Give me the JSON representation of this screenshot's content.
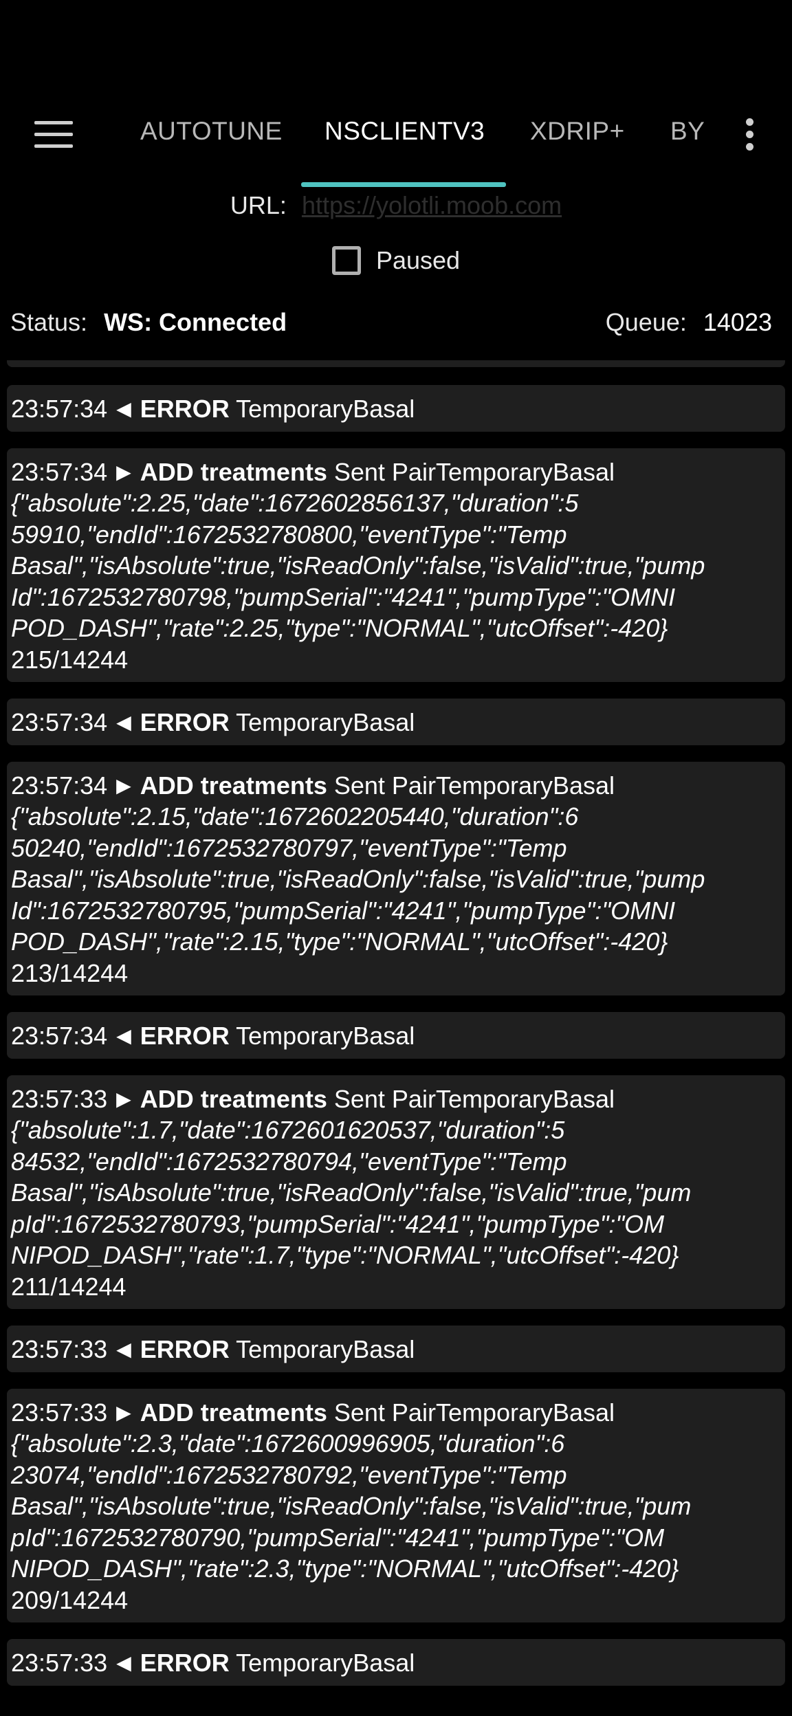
{
  "toolbar": {
    "menu_icon": "hamburger-menu-icon",
    "overflow_icon": "more-vertical-icon",
    "accent_color": "#4fc3c0",
    "tabs": [
      {
        "label": "AUTOTUNE",
        "active": false
      },
      {
        "label": "NSCLIENTV3",
        "active": true
      },
      {
        "label": "XDRIP+",
        "active": false
      },
      {
        "label": "BY",
        "active": false
      }
    ]
  },
  "url": {
    "label": "URL:",
    "value": "https://yolotli.moob.com"
  },
  "paused": {
    "label": "Paused",
    "checked": false
  },
  "status": {
    "label": "Status:",
    "value": "WS: Connected",
    "queue_label": "Queue:",
    "queue_value": "14023"
  },
  "logs": [
    {
      "time": "23:57:34",
      "dir": "◄",
      "action": "ERROR",
      "text": "TemporaryBasal"
    },
    {
      "time": "23:57:34",
      "dir": "►",
      "action": "ADD treatments",
      "text": "Sent PairTemporaryBasal",
      "json": "{\"absolute\":2.25,\"date\":1672602856137,\"duration\":5\n59910,\"endId\":1672532780800,\"eventType\":\"Temp\nBasal\",\"isAbsolute\":true,\"isReadOnly\":false,\"isValid\":true,\"pump\nId\":1672532780798,\"pumpSerial\":\"4241\",\"pumpType\":\"OMNI\nPOD_DASH\",\"rate\":2.25,\"type\":\"NORMAL\",\"utcOffset\":-420}",
      "count": "215/14244"
    },
    {
      "time": "23:57:34",
      "dir": "◄",
      "action": "ERROR",
      "text": "TemporaryBasal"
    },
    {
      "time": "23:57:34",
      "dir": "►",
      "action": "ADD treatments",
      "text": "Sent PairTemporaryBasal",
      "json": "{\"absolute\":2.15,\"date\":1672602205440,\"duration\":6\n50240,\"endId\":1672532780797,\"eventType\":\"Temp\nBasal\",\"isAbsolute\":true,\"isReadOnly\":false,\"isValid\":true,\"pump\nId\":1672532780795,\"pumpSerial\":\"4241\",\"pumpType\":\"OMNI\nPOD_DASH\",\"rate\":2.15,\"type\":\"NORMAL\",\"utcOffset\":-420}",
      "count": "213/14244"
    },
    {
      "time": "23:57:34",
      "dir": "◄",
      "action": "ERROR",
      "text": "TemporaryBasal"
    },
    {
      "time": "23:57:33",
      "dir": "►",
      "action": "ADD treatments",
      "text": "Sent PairTemporaryBasal",
      "json": "{\"absolute\":1.7,\"date\":1672601620537,\"duration\":5\n84532,\"endId\":1672532780794,\"eventType\":\"Temp\nBasal\",\"isAbsolute\":true,\"isReadOnly\":false,\"isValid\":true,\"pum\npId\":1672532780793,\"pumpSerial\":\"4241\",\"pumpType\":\"OM\nNIPOD_DASH\",\"rate\":1.7,\"type\":\"NORMAL\",\"utcOffset\":-420}",
      "count": "211/14244"
    },
    {
      "time": "23:57:33",
      "dir": "◄",
      "action": "ERROR",
      "text": "TemporaryBasal"
    },
    {
      "time": "23:57:33",
      "dir": "►",
      "action": "ADD treatments",
      "text": "Sent PairTemporaryBasal",
      "json": "{\"absolute\":2.3,\"date\":1672600996905,\"duration\":6\n23074,\"endId\":1672532780792,\"eventType\":\"Temp\nBasal\",\"isAbsolute\":true,\"isReadOnly\":false,\"isValid\":true,\"pum\npId\":1672532780790,\"pumpSerial\":\"4241\",\"pumpType\":\"OM\nNIPOD_DASH\",\"rate\":2.3,\"type\":\"NORMAL\",\"utcOffset\":-420}",
      "count": "209/14244"
    },
    {
      "time": "23:57:33",
      "dir": "◄",
      "action": "ERROR",
      "text": "TemporaryBasal"
    }
  ]
}
